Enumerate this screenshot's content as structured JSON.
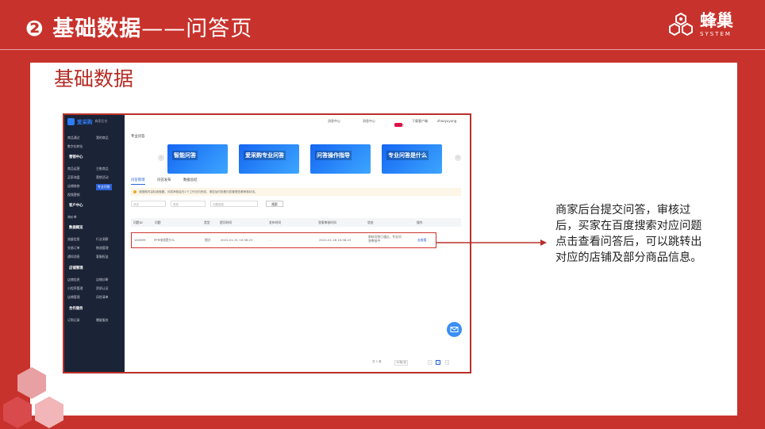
{
  "banner": {
    "number": "❷",
    "title_bold": "基础数据",
    "title_dash": "——",
    "title_rest": "问答页"
  },
  "logo": {
    "text_cn": "蜂巢",
    "text_en": "SYSTEM"
  },
  "section_title": "基础数据",
  "screenshot": {
    "brand": {
      "name": "爱采购",
      "sub": "商家后台"
    },
    "topbar": [
      "消息中心",
      "消息中心",
      "工作台",
      "下载客户端",
      "zhaoyuyang"
    ],
    "topbar_badge": "new",
    "sidebar": [
      {
        "label": "商品通过",
        "type": "item"
      },
      {
        "label": "我的商品",
        "type": "item"
      },
      {
        "label": "数字化转化",
        "type": "item"
      },
      {
        "label": "营销中心",
        "type": "section"
      },
      {
        "label": "商品运营",
        "type": "item"
      },
      {
        "label": "主推商品",
        "type": "item"
      },
      {
        "label": "买家询盘",
        "type": "item"
      },
      {
        "label": "营销活动",
        "type": "item"
      },
      {
        "label": "店铺装修",
        "type": "item"
      },
      {
        "label": "专业问答",
        "type": "active"
      },
      {
        "label": "视频营销",
        "type": "item"
      },
      {
        "label": "客户中心",
        "type": "section"
      },
      {
        "label": "询价单",
        "type": "item"
      },
      {
        "label": "数据概览",
        "type": "section"
      },
      {
        "label": "流量信息",
        "type": "item"
      },
      {
        "label": "行业洞察",
        "type": "item"
      },
      {
        "label": "交易订单",
        "type": "item"
      },
      {
        "label": "物流管理",
        "type": "item"
      },
      {
        "label": "通知消息",
        "type": "item"
      },
      {
        "label": "客服权益",
        "type": "item"
      },
      {
        "label": "店铺管理",
        "type": "section"
      },
      {
        "label": "店铺信息",
        "type": "item"
      },
      {
        "label": "店铺诊断",
        "type": "item"
      },
      {
        "label": "小程序管理",
        "type": "item"
      },
      {
        "label": "资质认证",
        "type": "item"
      },
      {
        "label": "店铺管理",
        "type": "item"
      },
      {
        "label": "风险清单",
        "type": "item"
      },
      {
        "label": "合作服务",
        "type": "section"
      },
      {
        "label": "订购记录",
        "type": "item"
      },
      {
        "label": "爆量服务",
        "type": "item"
      }
    ],
    "crumb": "专业问答",
    "banners": [
      "智能问答",
      "爱采购专业问答",
      "问答操作指导",
      "专业问答是什么"
    ],
    "tabs": [
      "问答管理",
      "问答发布",
      "数据总结"
    ],
    "notice": "请按照内容标准做题，问答审核会在1个工作日内完成，请您及时查看问答管理查看审核状态。",
    "filters": [
      "状态",
      "类型",
      "问题搜索"
    ],
    "search_btn": "搜索",
    "table_headers": [
      "问题ID",
      "问题",
      "类型",
      "提问时间",
      "发布时间",
      "答案审核时间",
      "状态",
      "操作"
    ],
    "row": {
      "id": "183899",
      "question": "PPR电线是什么",
      "type": "图文",
      "ask_time": "2022-01-31 10:38:23",
      "publish_time": "-",
      "audit_time": "2022-01-28 10:38:23",
      "status": "审核问答已通过，专业问答审核中",
      "action": "去查看"
    },
    "pager": {
      "total": "共 1 条",
      "size": "10条/页",
      "page": "1"
    }
  },
  "description": "商家后台提交问答，审核过后，买家在百度搜索对应问题点击查看问答后，可以跳转出对应的店铺及部分商品信息。"
}
